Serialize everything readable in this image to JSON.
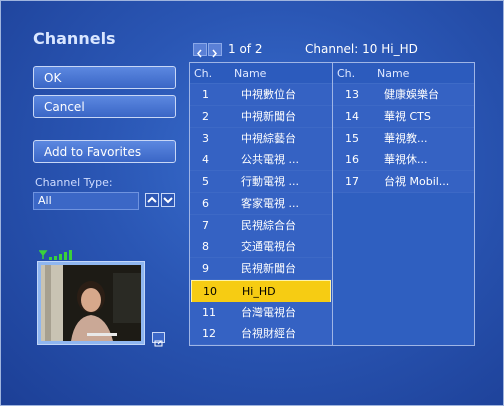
{
  "title": "Channels",
  "buttons": {
    "ok": "OK",
    "cancel": "Cancel",
    "favorites": "Add to Favorites"
  },
  "channel_type": {
    "label": "Channel Type:",
    "value": "All"
  },
  "pager": {
    "page_text": "1 of 2",
    "current_channel": "Channel: 10 Hi_HD"
  },
  "list": {
    "header_ch": "Ch.",
    "header_name": "Name",
    "left": [
      {
        "num": "1",
        "name": "中視數位台"
      },
      {
        "num": "2",
        "name": "中視新聞台"
      },
      {
        "num": "3",
        "name": "中視綜藝台"
      },
      {
        "num": "4",
        "name": "公共電視 ..."
      },
      {
        "num": "5",
        "name": "行動電視 ..."
      },
      {
        "num": "6",
        "name": "客家電視 ..."
      },
      {
        "num": "7",
        "name": "民視綜合台"
      },
      {
        "num": "8",
        "name": "交通電視台"
      },
      {
        "num": "9",
        "name": "民視新聞台"
      },
      {
        "num": "10",
        "name": "Hi_HD",
        "selected": true
      },
      {
        "num": "11",
        "name": "台灣電視台"
      },
      {
        "num": "12",
        "name": "台視財經台"
      }
    ],
    "right": [
      {
        "num": "13",
        "name": "健康娛樂台"
      },
      {
        "num": "14",
        "name": "華視 CTS"
      },
      {
        "num": "15",
        "name": "華視教..."
      },
      {
        "num": "16",
        "name": "華視休..."
      },
      {
        "num": "17",
        "name": "台視 Mobil..."
      }
    ]
  },
  "colors": {
    "selected_row": "#f6cc13",
    "background": "#2a56b4",
    "signal": "#3ad13a"
  }
}
